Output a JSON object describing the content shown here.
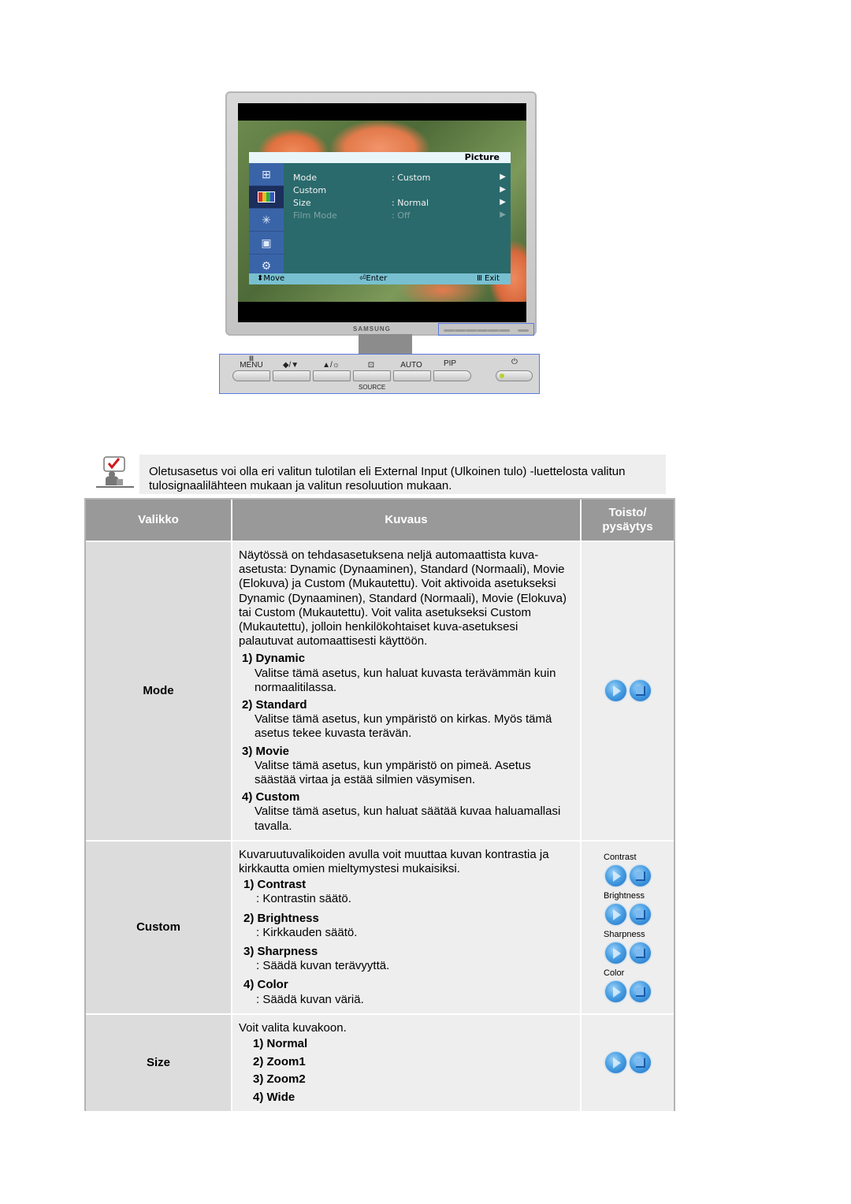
{
  "monitor": {
    "brand": "SAMSUNG",
    "osd": {
      "title": "Picture",
      "side_icons": [
        "input-icon",
        "picture-icon",
        "magic-icon",
        "pip-icon",
        "setup-icon"
      ],
      "rows": [
        {
          "label": "Mode",
          "value": ": Custom",
          "arrow": "▶",
          "enabled": true
        },
        {
          "label": "Custom",
          "value": "",
          "arrow": "▶",
          "enabled": true
        },
        {
          "label": "Size",
          "value": ": Normal",
          "arrow": "▶",
          "enabled": true
        },
        {
          "label": "Film Mode",
          "value": ": Off",
          "arrow": "▶",
          "enabled": false
        }
      ],
      "footer": {
        "move": "⬍Move",
        "enter": "⏎Enter",
        "exit": "Ⅲ Exit"
      }
    },
    "panel": {
      "buttons": [
        "MENU",
        "◆/▼",
        "▲/☼",
        "⊡",
        "AUTO",
        "PIP"
      ],
      "menu_glyph": "Ⅲ",
      "source": "SOURCE",
      "power": "⏻"
    }
  },
  "note": {
    "text": "Oletusasetus voi olla eri valitun tulotilan eli External Input (Ulkoinen tulo) -luettelosta valitun tulosignaalilähteen mukaan ja valitun resoluution mukaan."
  },
  "table": {
    "headers": [
      "Valikko",
      "Kuvaus",
      "Toisto/ pysäytys"
    ],
    "mode": {
      "menu": "Mode",
      "intro": "Näytössä on tehdasasetuksena neljä automaattista kuva-asetusta: Dynamic (Dynaaminen), Standard (Normaali), Movie (Elokuva) ja Custom (Mukautettu). Voit aktivoida asetukseksi Dynamic (Dynaaminen), Standard (Normaali), Movie (Elokuva) tai Custom (Mukautettu). Voit valita asetukseksi Custom (Mukautettu), jolloin henkilökohtaiset kuva-asetuksesi palautuvat automaattisesti käyttöön.",
      "items": [
        {
          "title": "1) Dynamic",
          "text": "Valitse tämä asetus, kun haluat kuvasta terävämmän kuin normaalitilassa."
        },
        {
          "title": "2) Standard",
          "text": "Valitse tämä asetus, kun ympäristö on kirkas. Myös tämä asetus tekee kuvasta terävän."
        },
        {
          "title": "3) Movie",
          "text": "Valitse tämä asetus, kun ympäristö on pimeä. Asetus säästää virtaa ja estää silmien väsymisen."
        },
        {
          "title": "4) Custom",
          "text": "Valitse tämä asetus, kun haluat säätää kuvaa haluamallasi tavalla."
        }
      ]
    },
    "custom": {
      "menu": "Custom",
      "intro": "Kuvaruutuvalikoiden avulla voit muuttaa kuvan kontrastia ja kirkkautta omien mieltymystesi mukaisiksi.",
      "items": [
        {
          "title": "1) Contrast",
          "text": ": Kontrastin säätö."
        },
        {
          "title": "2) Brightness",
          "text": ": Kirkkauden säätö."
        },
        {
          "title": "3) Sharpness",
          "text": ": Säädä kuvan terävyyttä."
        },
        {
          "title": "4) Color",
          "text": ": Säädä kuvan väriä."
        }
      ],
      "media_labels": [
        "Contrast",
        "Brightness",
        "Sharpness",
        "Color"
      ]
    },
    "size": {
      "menu": "Size",
      "intro": "Voit valita kuvakoon.",
      "items": [
        "1) Normal",
        "2) Zoom1",
        "3) Zoom2",
        "4) Wide"
      ]
    }
  }
}
